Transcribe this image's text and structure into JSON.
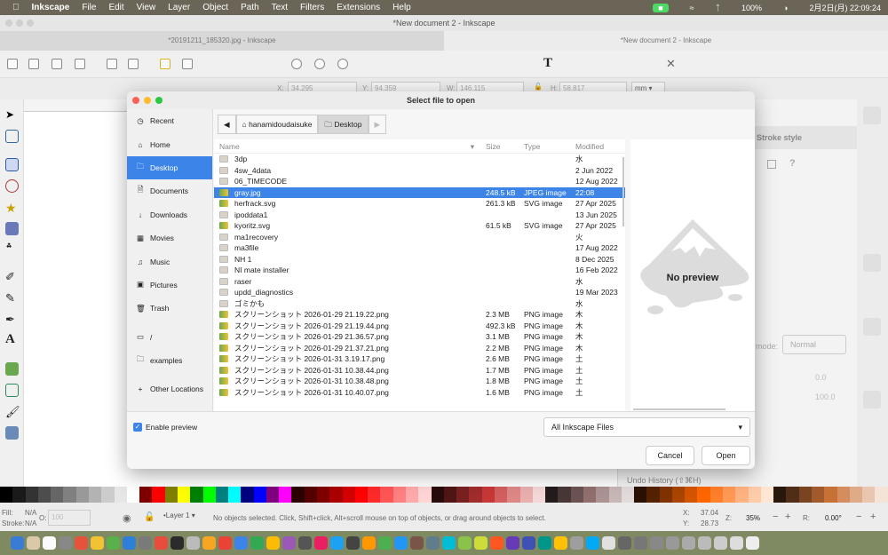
{
  "menubar": {
    "app": "Inkscape",
    "items": [
      "File",
      "Edit",
      "View",
      "Layer",
      "Object",
      "Path",
      "Text",
      "Filters",
      "Extensions",
      "Help"
    ],
    "battery": "100%",
    "clock": "2月2日(月) 22:09:24"
  },
  "window": {
    "title": "*New document 2 - Inkscape",
    "tabs": [
      "*20191211_185320.jpg - Inkscape",
      "*New document 2 - Inkscape"
    ]
  },
  "controls": {
    "x_label": "X:",
    "x": "34.295",
    "y_label": "Y:",
    "y": "94.359",
    "w_label": "W:",
    "w": "146.115",
    "h_label": "H:",
    "h": "58.817",
    "unit": "mm"
  },
  "dock": {
    "stroke_tab": "Stroke style",
    "blend_label": "mode:",
    "blend": "Normal",
    "blur": "0.0",
    "opacity": "100.0",
    "undo_history": "Undo History (⇧⌘H)"
  },
  "dialog": {
    "title": "Select file to open",
    "places": [
      {
        "label": "Recent",
        "icon": "clock-icon"
      },
      {
        "label": "Home",
        "icon": "home-icon"
      },
      {
        "label": "Desktop",
        "icon": "folder-icon",
        "selected": true
      },
      {
        "label": "Documents",
        "icon": "document-icon"
      },
      {
        "label": "Downloads",
        "icon": "download-icon"
      },
      {
        "label": "Movies",
        "icon": "film-icon"
      },
      {
        "label": "Music",
        "icon": "music-icon"
      },
      {
        "label": "Pictures",
        "icon": "picture-icon"
      },
      {
        "label": "Trash",
        "icon": "trash-icon"
      },
      {
        "label": "/",
        "icon": "drive-icon"
      },
      {
        "label": "examples",
        "icon": "folder-icon"
      },
      {
        "label": "Other Locations",
        "icon": "plus-icon"
      }
    ],
    "path": [
      "hanamidoudaisuke",
      "Desktop"
    ],
    "columns": {
      "name": "Name",
      "size": "Size",
      "type": "Type",
      "modified": "Modified"
    },
    "files": [
      {
        "name": "3dp",
        "kind": "folder",
        "size": "",
        "type": "",
        "modified": "水"
      },
      {
        "name": "4sw_4data",
        "kind": "folder",
        "size": "",
        "type": "",
        "modified": "2 Jun 2022"
      },
      {
        "name": "06_TIMECODE",
        "kind": "folder",
        "size": "",
        "type": "",
        "modified": "12 Aug 2022"
      },
      {
        "name": "gray.jpg",
        "kind": "img",
        "size": "248.5 kB",
        "type": "JPEG image",
        "modified": "22:08",
        "selected": true
      },
      {
        "name": "herfrack.svg",
        "kind": "img",
        "size": "261.3 kB",
        "type": "SVG image",
        "modified": "27 Apr 2025"
      },
      {
        "name": "ipoddata1",
        "kind": "folder",
        "size": "",
        "type": "",
        "modified": "13 Jun 2025"
      },
      {
        "name": "kyoritz.svg",
        "kind": "img",
        "size": "61.5 kB",
        "type": "SVG image",
        "modified": "27 Apr 2025"
      },
      {
        "name": "ma1recovery",
        "kind": "folder",
        "size": "",
        "type": "",
        "modified": "火"
      },
      {
        "name": "ma3file",
        "kind": "folder",
        "size": "",
        "type": "",
        "modified": "17 Aug 2022"
      },
      {
        "name": "NH 1",
        "kind": "folder",
        "size": "",
        "type": "",
        "modified": "8 Dec 2025"
      },
      {
        "name": "NI mate installer",
        "kind": "folder",
        "size": "",
        "type": "",
        "modified": "16 Feb 2022"
      },
      {
        "name": "raser",
        "kind": "folder",
        "size": "",
        "type": "",
        "modified": "水"
      },
      {
        "name": "updd_diagnostics",
        "kind": "folder",
        "size": "",
        "type": "",
        "modified": "19 Mar 2023"
      },
      {
        "name": "ゴミかも",
        "kind": "folder",
        "size": "",
        "type": "",
        "modified": "水"
      },
      {
        "name": "スクリーンショット 2026-01-29 21.19.22.png",
        "kind": "img",
        "size": "2.3 MB",
        "type": "PNG image",
        "modified": "木"
      },
      {
        "name": "スクリーンショット 2026-01-29 21.19.44.png",
        "kind": "img",
        "size": "492.3 kB",
        "type": "PNG image",
        "modified": "木"
      },
      {
        "name": "スクリーンショット 2026-01-29 21.36.57.png",
        "kind": "img",
        "size": "3.1 MB",
        "type": "PNG image",
        "modified": "木"
      },
      {
        "name": "スクリーンショット 2026-01-29 21.37.21.png",
        "kind": "img",
        "size": "2.2 MB",
        "type": "PNG image",
        "modified": "木"
      },
      {
        "name": "スクリーンショット 2026-01-31 3.19.17.png",
        "kind": "img",
        "size": "2.6 MB",
        "type": "PNG image",
        "modified": "土"
      },
      {
        "name": "スクリーンショット 2026-01-31 10.38.44.png",
        "kind": "img",
        "size": "1.7 MB",
        "type": "PNG image",
        "modified": "土"
      },
      {
        "name": "スクリーンショット 2026-01-31 10.38.48.png",
        "kind": "img",
        "size": "1.8 MB",
        "type": "PNG image",
        "modified": "土"
      },
      {
        "name": "スクリーンショット 2026-01-31 10.40.07.png",
        "kind": "img",
        "size": "1.6 MB",
        "type": "PNG image",
        "modified": "土"
      }
    ],
    "preview_text": "No preview",
    "enable_preview": "Enable preview",
    "enable_preview_checked": true,
    "filter": "All Inkscape Files",
    "cancel": "Cancel",
    "open": "Open"
  },
  "statusbar": {
    "fill_label": "Fill:",
    "fill": "N/A",
    "stroke_label": "Stroke:",
    "stroke": "N/A",
    "opacity_label": "O:",
    "opacity": "100",
    "layer": "•Layer 1",
    "message": "No objects selected. Click, Shift+click, Alt+scroll mouse on top of objects, or drag around objects to select.",
    "x_label": "X:",
    "x": "37.04",
    "y_label": "Y:",
    "y": "28.73",
    "zoom_label": "Z:",
    "zoom": "35%",
    "rot_label": "R:",
    "rotation": "0.00°"
  },
  "colors": {
    "accent": "#3c84e8",
    "palette": [
      "#000000",
      "#1a1a1a",
      "#333333",
      "#4d4d4d",
      "#666666",
      "#808080",
      "#999999",
      "#b3b3b3",
      "#cccccc",
      "#e6e6e6",
      "#ffffff",
      "#800000",
      "#ff0000",
      "#808000",
      "#ffff00",
      "#008000",
      "#00ff00",
      "#008080",
      "#00ffff",
      "#000080",
      "#0000ff",
      "#800080",
      "#ff00ff",
      "#2b0000",
      "#550000",
      "#800000",
      "#aa0000",
      "#d40000",
      "#ff0000",
      "#ff2a2a",
      "#ff5555",
      "#ff8080",
      "#ffaaaa",
      "#ffd5d5",
      "#280b0b",
      "#501616",
      "#782121",
      "#a02c2c",
      "#c83737",
      "#d35f5f",
      "#de8787",
      "#e9afaf",
      "#f4d7d7",
      "#241c1c",
      "#483737",
      "#6c5353",
      "#916f6f",
      "#ac9393",
      "#c8b7b7",
      "#e3dbdb",
      "#2b1100",
      "#552200",
      "#803300",
      "#aa4400",
      "#d45500",
      "#ff6600",
      "#ff7f2a",
      "#ff9955",
      "#ffb380",
      "#ffccaa",
      "#ffe6d5",
      "#28170b",
      "#502d16",
      "#784421",
      "#a05a2c",
      "#c87137",
      "#d38d5f",
      "#deaa87",
      "#e9c6af",
      "#f4e3d7"
    ]
  }
}
